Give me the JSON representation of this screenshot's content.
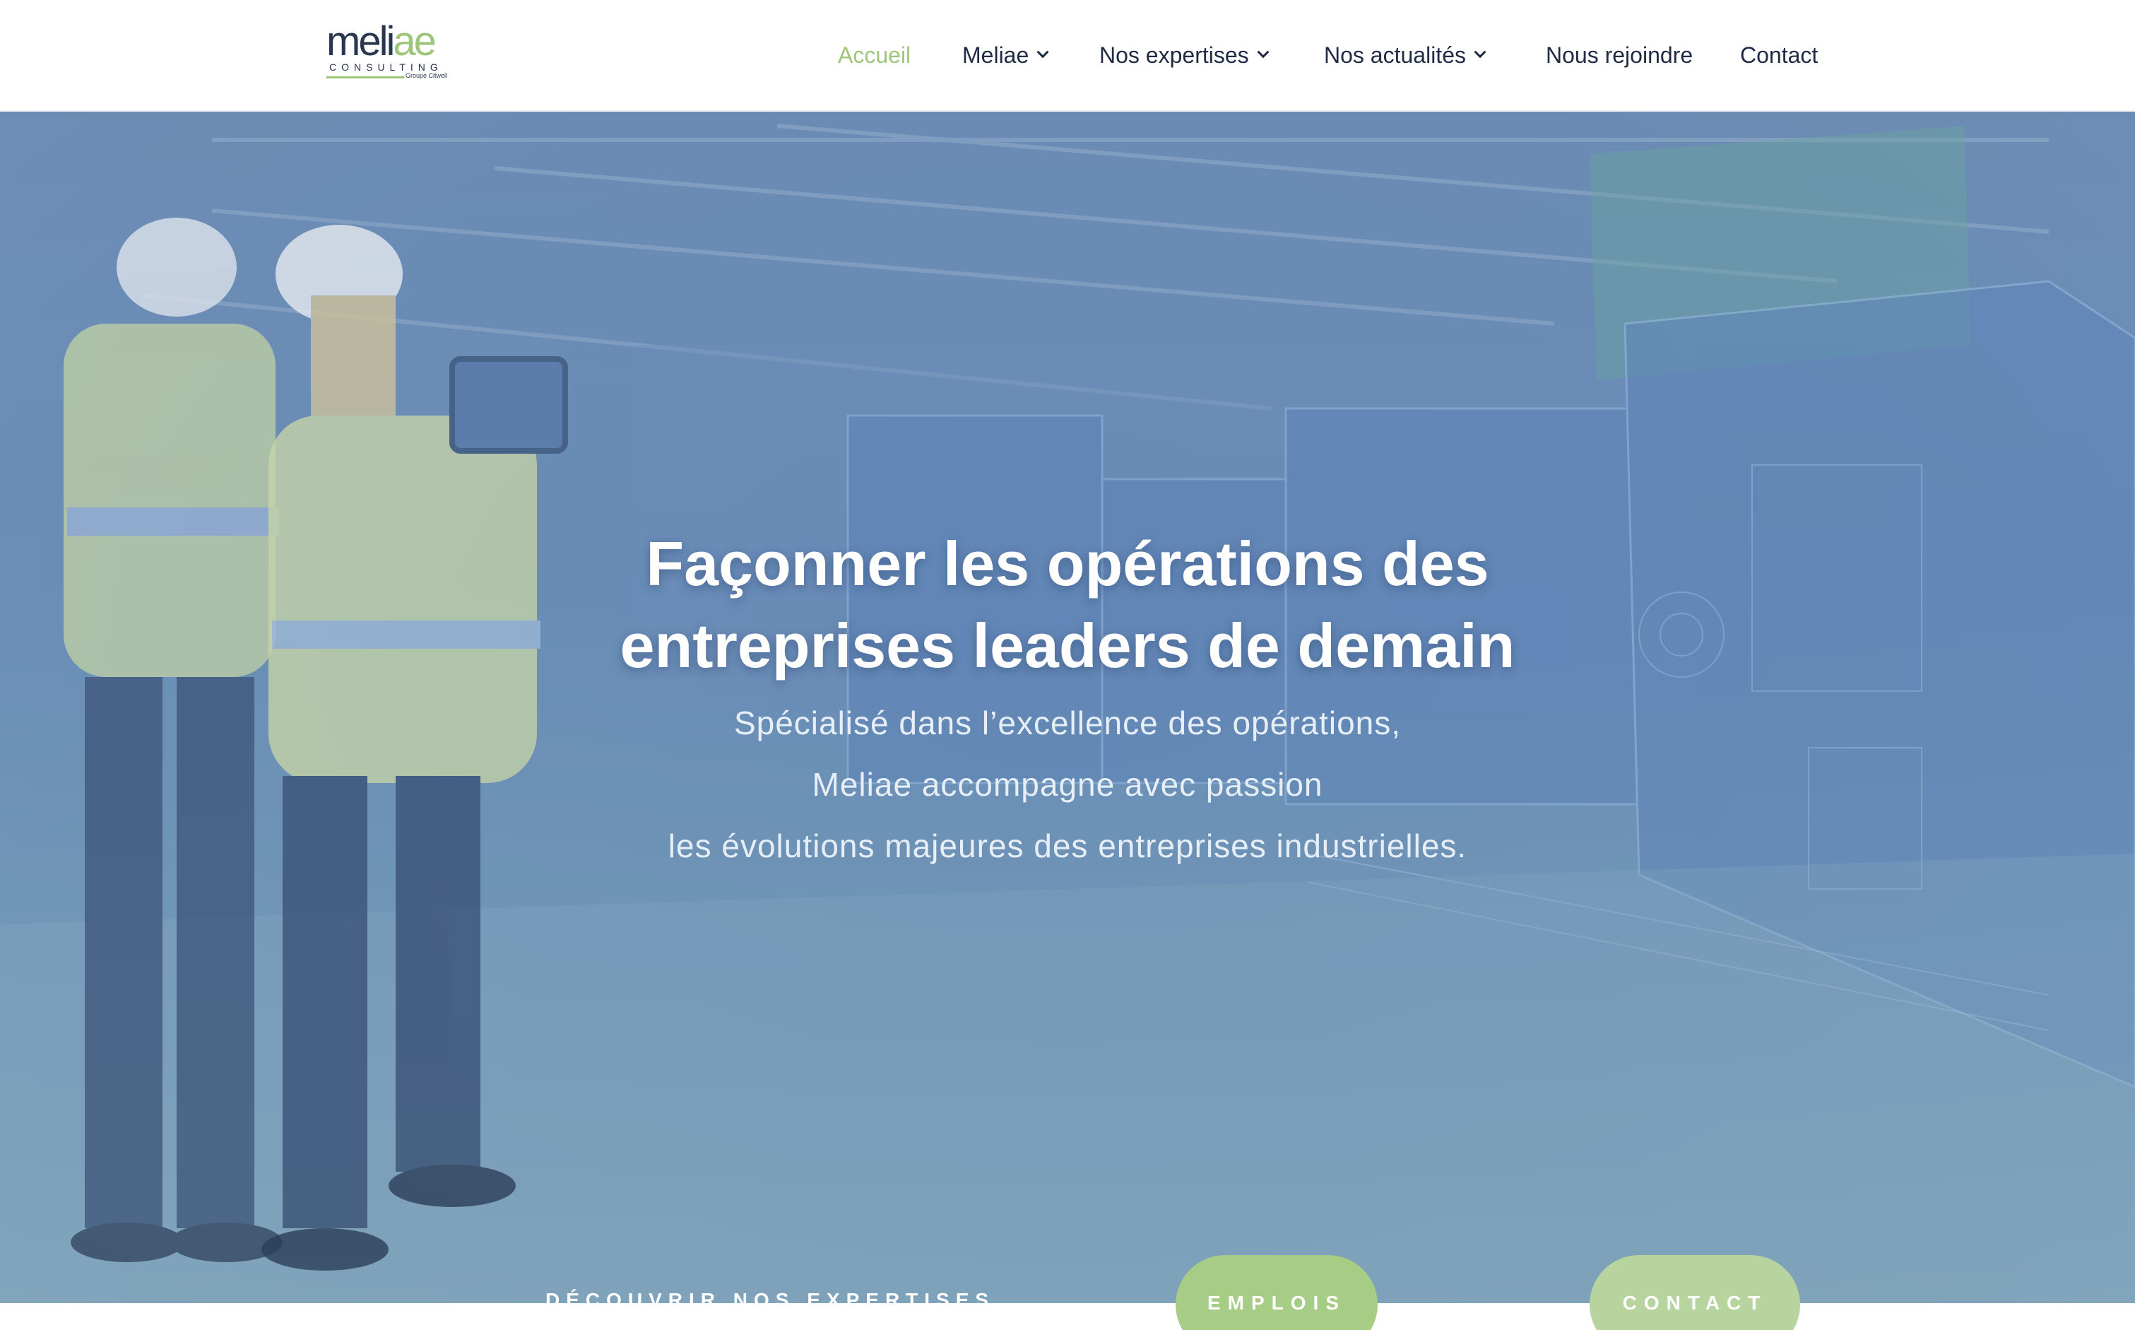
{
  "brand": {
    "logo_part1": "meli",
    "logo_part2": "ae",
    "logo_sub": "CONSULTING",
    "logo_tag": "Groupe Citwell",
    "brand_green": "#9dc67a",
    "brand_navy": "#2a3550"
  },
  "nav": {
    "items": [
      {
        "label": "Accueil",
        "active": true,
        "has_dropdown": false
      },
      {
        "label": "Meliae",
        "active": false,
        "has_dropdown": true
      },
      {
        "label": "Nos expertises",
        "active": false,
        "has_dropdown": true
      },
      {
        "label": "Nos actualités",
        "active": false,
        "has_dropdown": true
      },
      {
        "label": "Nous rejoindre",
        "active": false,
        "has_dropdown": false
      },
      {
        "label": "Contact",
        "active": false,
        "has_dropdown": false
      }
    ]
  },
  "hero": {
    "title_line1": "Façonner les opérations des",
    "title_line2": "entreprises leaders de demain",
    "sub_line1": "Spécialisé dans l’excellence des opérations,",
    "sub_line2": "Meliae accompagne avec passion",
    "sub_line3": "les évolutions majeures des entreprises industrielles."
  },
  "ctas": {
    "discover": "DÉCOUVRIR NOS EXPERTISES",
    "emplois": "EMPLOIS",
    "contact": "CONTACT"
  }
}
